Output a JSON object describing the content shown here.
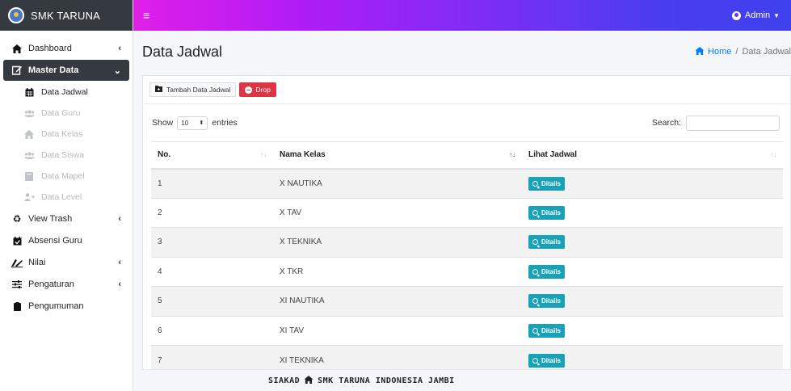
{
  "brand": {
    "name": "SMK TARUNA"
  },
  "navbar": {
    "user": "Admin"
  },
  "sidebar": {
    "items": [
      {
        "label": "Dashboard",
        "icon": "home-icon"
      },
      {
        "label": "Master Data",
        "icon": "edit-icon"
      },
      {
        "label": "View Trash",
        "icon": "recycle-icon"
      },
      {
        "label": "Absensi Guru",
        "icon": "calendar-check-icon"
      },
      {
        "label": "Nilai",
        "icon": "signature-icon"
      },
      {
        "label": "Pengaturan",
        "icon": "sliders-icon"
      },
      {
        "label": "Pengumuman",
        "icon": "clipboard-icon"
      }
    ],
    "sub_items": [
      {
        "label": "Data Jadwal",
        "icon": "calendar-icon"
      },
      {
        "label": "Data Guru",
        "icon": "users-icon"
      },
      {
        "label": "Data Kelas",
        "icon": "school-icon"
      },
      {
        "label": "Data Siswa",
        "icon": "users-icon"
      },
      {
        "label": "Data Mapel",
        "icon": "book-icon"
      },
      {
        "label": "Data Level",
        "icon": "user-plus-icon"
      }
    ]
  },
  "header": {
    "title": "Data Jadwal",
    "breadcrumb_home": "Home",
    "breadcrumb_current": "Data Jadwal"
  },
  "card": {
    "add_label": "Tambah Data Jadwal",
    "drop_label": "Drop",
    "show_label": "Show",
    "entries_value": "10",
    "entries_label": "entries",
    "search_label": "Search:"
  },
  "table": {
    "headers": [
      "No.",
      "Nama Kelas",
      "Lihat Jadwal"
    ],
    "detail_label": "Ditails",
    "rows": [
      {
        "no": "1",
        "kelas": "X NAUTIKA"
      },
      {
        "no": "2",
        "kelas": "X TAV"
      },
      {
        "no": "3",
        "kelas": "X TEKNIKA"
      },
      {
        "no": "4",
        "kelas": "X TKR"
      },
      {
        "no": "5",
        "kelas": "XI NAUTIKA"
      },
      {
        "no": "6",
        "kelas": "XI TAV"
      },
      {
        "no": "7",
        "kelas": "XI TEKNIKA"
      }
    ]
  },
  "footer": {
    "left": "SIAKAD",
    "right": "SMK TARUNA INDONESIA JAMBI"
  },
  "colors": {
    "info": "#17a2b8",
    "danger": "#dc3545",
    "dark": "#343a40",
    "link": "#007bff"
  }
}
